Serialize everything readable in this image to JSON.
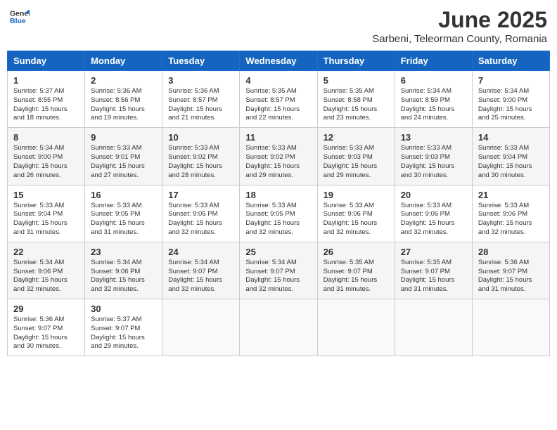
{
  "header": {
    "logo_line1": "General",
    "logo_line2": "Blue",
    "title": "June 2025",
    "subtitle": "Sarbeni, Teleorman County, Romania"
  },
  "calendar": {
    "days_of_week": [
      "Sunday",
      "Monday",
      "Tuesday",
      "Wednesday",
      "Thursday",
      "Friday",
      "Saturday"
    ],
    "weeks": [
      [
        {
          "day": "",
          "info": ""
        },
        {
          "day": "2",
          "info": "Sunrise: 5:36 AM\nSunset: 8:56 PM\nDaylight: 15 hours\nand 19 minutes."
        },
        {
          "day": "3",
          "info": "Sunrise: 5:36 AM\nSunset: 8:57 PM\nDaylight: 15 hours\nand 21 minutes."
        },
        {
          "day": "4",
          "info": "Sunrise: 5:35 AM\nSunset: 8:57 PM\nDaylight: 15 hours\nand 22 minutes."
        },
        {
          "day": "5",
          "info": "Sunrise: 5:35 AM\nSunset: 8:58 PM\nDaylight: 15 hours\nand 23 minutes."
        },
        {
          "day": "6",
          "info": "Sunrise: 5:34 AM\nSunset: 8:59 PM\nDaylight: 15 hours\nand 24 minutes."
        },
        {
          "day": "7",
          "info": "Sunrise: 5:34 AM\nSunset: 9:00 PM\nDaylight: 15 hours\nand 25 minutes."
        }
      ],
      [
        {
          "day": "8",
          "info": "Sunrise: 5:34 AM\nSunset: 9:00 PM\nDaylight: 15 hours\nand 26 minutes."
        },
        {
          "day": "9",
          "info": "Sunrise: 5:33 AM\nSunset: 9:01 PM\nDaylight: 15 hours\nand 27 minutes."
        },
        {
          "day": "10",
          "info": "Sunrise: 5:33 AM\nSunset: 9:02 PM\nDaylight: 15 hours\nand 28 minutes."
        },
        {
          "day": "11",
          "info": "Sunrise: 5:33 AM\nSunset: 9:02 PM\nDaylight: 15 hours\nand 29 minutes."
        },
        {
          "day": "12",
          "info": "Sunrise: 5:33 AM\nSunset: 9:03 PM\nDaylight: 15 hours\nand 29 minutes."
        },
        {
          "day": "13",
          "info": "Sunrise: 5:33 AM\nSunset: 9:03 PM\nDaylight: 15 hours\nand 30 minutes."
        },
        {
          "day": "14",
          "info": "Sunrise: 5:33 AM\nSunset: 9:04 PM\nDaylight: 15 hours\nand 30 minutes."
        }
      ],
      [
        {
          "day": "15",
          "info": "Sunrise: 5:33 AM\nSunset: 9:04 PM\nDaylight: 15 hours\nand 31 minutes."
        },
        {
          "day": "16",
          "info": "Sunrise: 5:33 AM\nSunset: 9:05 PM\nDaylight: 15 hours\nand 31 minutes."
        },
        {
          "day": "17",
          "info": "Sunrise: 5:33 AM\nSunset: 9:05 PM\nDaylight: 15 hours\nand 32 minutes."
        },
        {
          "day": "18",
          "info": "Sunrise: 5:33 AM\nSunset: 9:05 PM\nDaylight: 15 hours\nand 32 minutes."
        },
        {
          "day": "19",
          "info": "Sunrise: 5:33 AM\nSunset: 9:06 PM\nDaylight: 15 hours\nand 32 minutes."
        },
        {
          "day": "20",
          "info": "Sunrise: 5:33 AM\nSunset: 9:06 PM\nDaylight: 15 hours\nand 32 minutes."
        },
        {
          "day": "21",
          "info": "Sunrise: 5:33 AM\nSunset: 9:06 PM\nDaylight: 15 hours\nand 32 minutes."
        }
      ],
      [
        {
          "day": "22",
          "info": "Sunrise: 5:34 AM\nSunset: 9:06 PM\nDaylight: 15 hours\nand 32 minutes."
        },
        {
          "day": "23",
          "info": "Sunrise: 5:34 AM\nSunset: 9:06 PM\nDaylight: 15 hours\nand 32 minutes."
        },
        {
          "day": "24",
          "info": "Sunrise: 5:34 AM\nSunset: 9:07 PM\nDaylight: 15 hours\nand 32 minutes."
        },
        {
          "day": "25",
          "info": "Sunrise: 5:34 AM\nSunset: 9:07 PM\nDaylight: 15 hours\nand 32 minutes."
        },
        {
          "day": "26",
          "info": "Sunrise: 5:35 AM\nSunset: 9:07 PM\nDaylight: 15 hours\nand 31 minutes."
        },
        {
          "day": "27",
          "info": "Sunrise: 5:35 AM\nSunset: 9:07 PM\nDaylight: 15 hours\nand 31 minutes."
        },
        {
          "day": "28",
          "info": "Sunrise: 5:36 AM\nSunset: 9:07 PM\nDaylight: 15 hours\nand 31 minutes."
        }
      ],
      [
        {
          "day": "29",
          "info": "Sunrise: 5:36 AM\nSunset: 9:07 PM\nDaylight: 15 hours\nand 30 minutes."
        },
        {
          "day": "30",
          "info": "Sunrise: 5:37 AM\nSunset: 9:07 PM\nDaylight: 15 hours\nand 29 minutes."
        },
        {
          "day": "",
          "info": ""
        },
        {
          "day": "",
          "info": ""
        },
        {
          "day": "",
          "info": ""
        },
        {
          "day": "",
          "info": ""
        },
        {
          "day": "",
          "info": ""
        }
      ]
    ],
    "week0_day1": {
      "day": "1",
      "info": "Sunrise: 5:37 AM\nSunset: 8:55 PM\nDaylight: 15 hours\nand 18 minutes."
    }
  }
}
